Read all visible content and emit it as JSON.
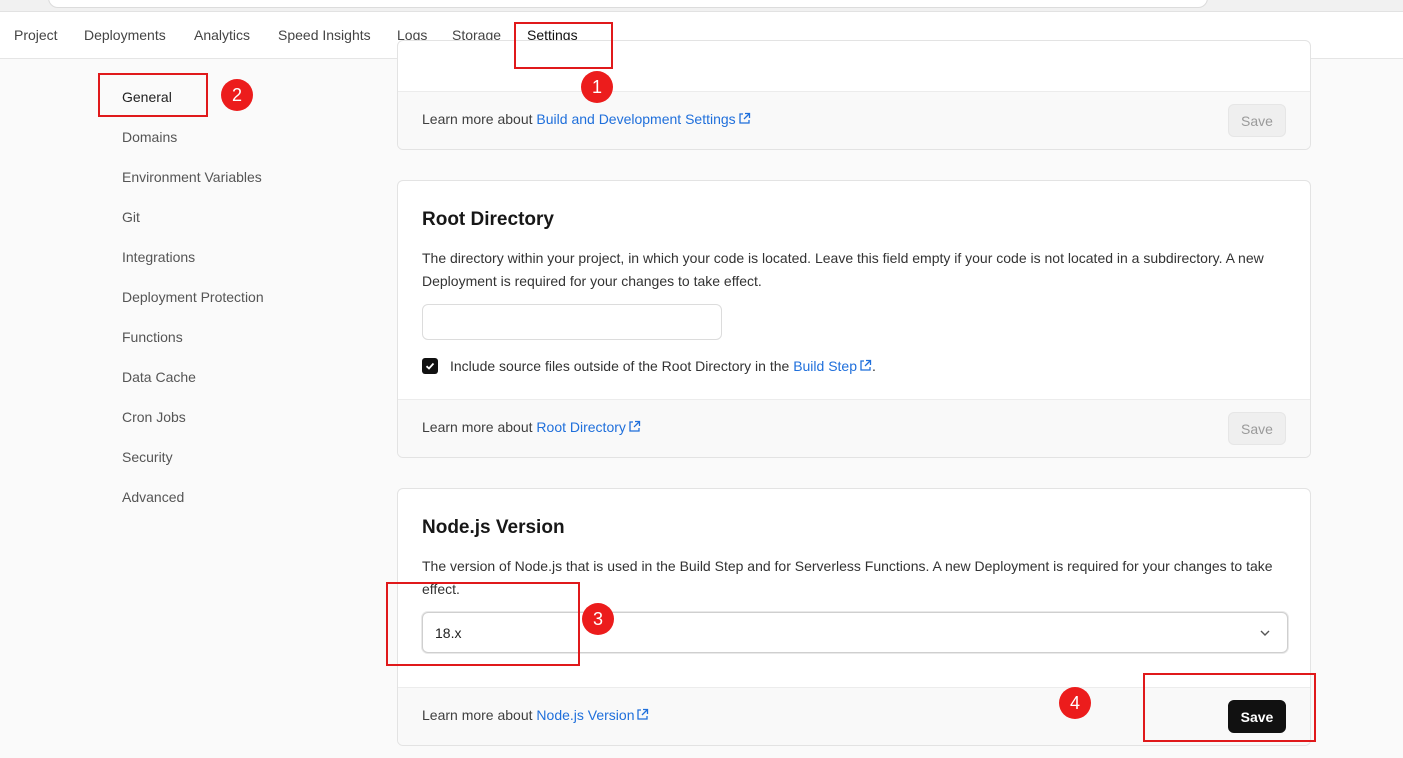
{
  "nav": {
    "tabs": [
      {
        "label": "Project"
      },
      {
        "label": "Deployments"
      },
      {
        "label": "Analytics"
      },
      {
        "label": "Speed Insights"
      },
      {
        "label": "Logs"
      },
      {
        "label": "Storage"
      },
      {
        "label": "Settings"
      }
    ],
    "active_tab": "Settings"
  },
  "sidebar": {
    "items": [
      {
        "label": "General"
      },
      {
        "label": "Domains"
      },
      {
        "label": "Environment Variables"
      },
      {
        "label": "Git"
      },
      {
        "label": "Integrations"
      },
      {
        "label": "Deployment Protection"
      },
      {
        "label": "Functions"
      },
      {
        "label": "Data Cache"
      },
      {
        "label": "Cron Jobs"
      },
      {
        "label": "Security"
      },
      {
        "label": "Advanced"
      }
    ],
    "active_item": "General"
  },
  "build_card": {
    "footer_prefix": "Learn more about",
    "footer_link": "Build and Development Settings",
    "save_label": "Save"
  },
  "root_card": {
    "title": "Root Directory",
    "description": "The directory within your project, in which your code is located. Leave this field empty if your code is not located in a subdirectory. A new Deployment is required for your changes to take effect.",
    "input_value": "",
    "checkbox_checked": true,
    "checkbox_label": "Include source files outside of the Root Directory in the",
    "checkbox_link": "Build Step",
    "checkbox_suffix": ".",
    "footer_prefix": "Learn more about",
    "footer_link": "Root Directory",
    "save_label": "Save"
  },
  "node_card": {
    "title": "Node.js Version",
    "description": "The version of Node.js that is used in the Build Step and for Serverless Functions. A new Deployment is required for your changes to take effect.",
    "select_value": "18.x",
    "footer_prefix": "Learn more about",
    "footer_link": "Node.js Version",
    "save_label": "Save"
  },
  "annotations": {
    "markers": [
      "1",
      "2",
      "3",
      "4"
    ],
    "color": "#e0191b"
  },
  "colors": {
    "link": "#1f6fdb",
    "primary_button": "#111111"
  }
}
